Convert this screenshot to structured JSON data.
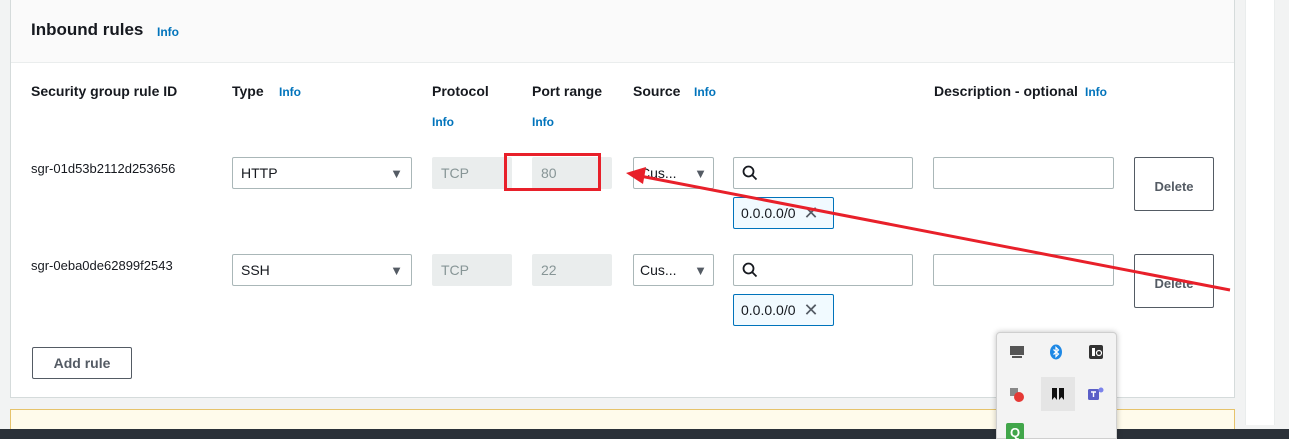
{
  "section": {
    "title": "Inbound rules",
    "info_label": "Info"
  },
  "columns": {
    "rule_id": "Security group rule ID",
    "type": "Type",
    "type_info": "Info",
    "protocol": "Protocol",
    "protocol_info": "Info",
    "port_range": "Port range",
    "port_range_info": "Info",
    "source": "Source",
    "source_info": "Info",
    "description": "Description - optional",
    "description_info": "Info"
  },
  "rules": [
    {
      "id": "sgr-01d53b2112d253656",
      "type": "HTTP",
      "protocol": "TCP",
      "port": "80",
      "source": "Cus...",
      "source_search_value": "",
      "cidr": "0.0.0.0/0",
      "description": "",
      "delete_label": "Delete"
    },
    {
      "id": "sgr-0eba0de62899f2543",
      "type": "SSH",
      "protocol": "TCP",
      "port": "22",
      "source": "Cus...",
      "source_search_value": "",
      "cidr": "0.0.0.0/0",
      "description": "",
      "delete_label": "Delete"
    }
  ],
  "add_rule_label": "Add rule",
  "annotation": {
    "color": "#e8202a"
  },
  "tray": {
    "icons": [
      "monitor-icon",
      "bluetooth-icon",
      "app-icon",
      "extension-icon",
      "app-icon-2",
      "teams-icon",
      "qt-icon"
    ],
    "qt_glyph": "Q"
  }
}
